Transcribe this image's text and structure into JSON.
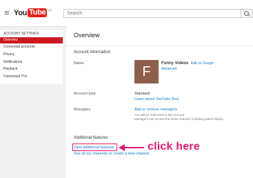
{
  "header": {
    "logo_you": "You",
    "logo_tube": "Tube",
    "logo_sup": "US",
    "search_placeholder": "Search"
  },
  "sidebar": {
    "heading": "ACCOUNT SETTINGS",
    "items": [
      {
        "label": "Overview",
        "active": true
      },
      {
        "label": "Connected accounts"
      },
      {
        "label": "Privacy"
      },
      {
        "label": "Notifications"
      },
      {
        "label": "Playback"
      },
      {
        "label": "Connected TVs"
      }
    ]
  },
  "main": {
    "title": "Overview",
    "account_info": {
      "section_title": "Account information",
      "name_label": "Name",
      "avatar_letter": "F",
      "channel_name": "Funny Videos",
      "edit_link": "Edit on Google",
      "advanced_link": "Advanced",
      "account_type_label": "Account type",
      "account_type_value": "Standard",
      "learn_link": "Learn about YouTube Red",
      "managers_label": "Managers",
      "managers_link": "Add or remove managers",
      "managers_note_1": "You will be redirected to My Account",
      "managers_note_2": "Managers can access the entire channel, including watch history."
    },
    "additional": {
      "section_title": "Additional features",
      "view_link": "View additional features",
      "see_all_link": "See all my channels or create a new channel"
    }
  },
  "annotation": {
    "text": "click here",
    "color": "#e6156e"
  }
}
